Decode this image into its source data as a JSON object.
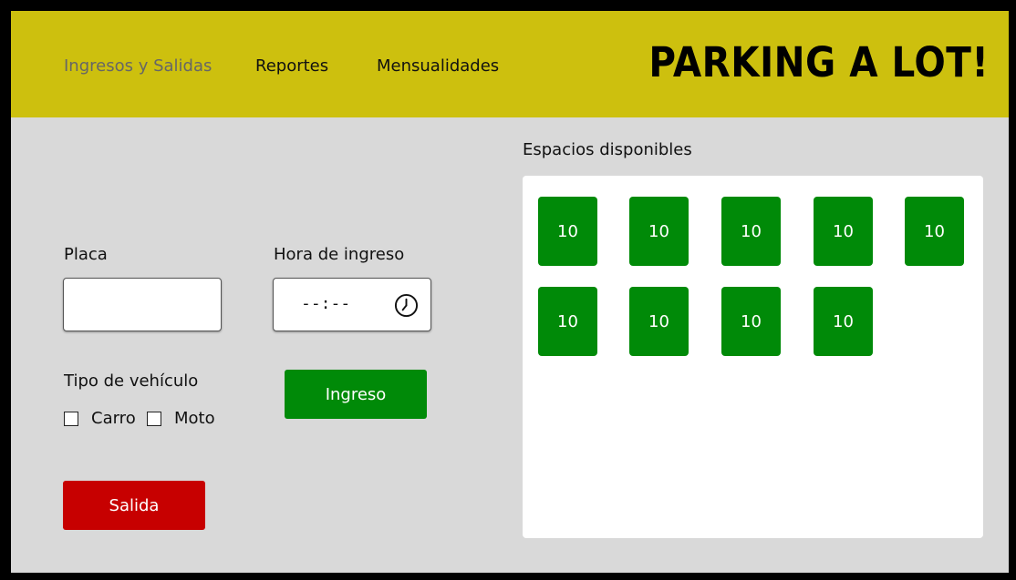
{
  "nav": {
    "items": [
      {
        "label": "Ingresos y Salidas",
        "active": true
      },
      {
        "label": "Reportes",
        "active": false
      },
      {
        "label": "Mensualidades",
        "active": false
      }
    ]
  },
  "brand": {
    "title": "PARKING A LOT!"
  },
  "form": {
    "placa_label": "Placa",
    "placa_value": "",
    "hora_label": "Hora de ingreso",
    "hora_value": "--:--",
    "tipo_label": "Tipo de vehículo",
    "options": [
      {
        "label": "Carro",
        "checked": false
      },
      {
        "label": "Moto",
        "checked": false
      }
    ],
    "ingreso_label": "Ingreso",
    "salida_label": "Salida"
  },
  "spaces": {
    "title": "Espacios disponibles",
    "items": [
      "10",
      "10",
      "10",
      "10",
      "10",
      "10",
      "10",
      "10",
      "10"
    ]
  },
  "colors": {
    "header": "#cdc00e",
    "available": "#008a08",
    "salida": "#c70000",
    "background": "#d9d9d9"
  },
  "icons": {
    "time": "clock-icon"
  }
}
